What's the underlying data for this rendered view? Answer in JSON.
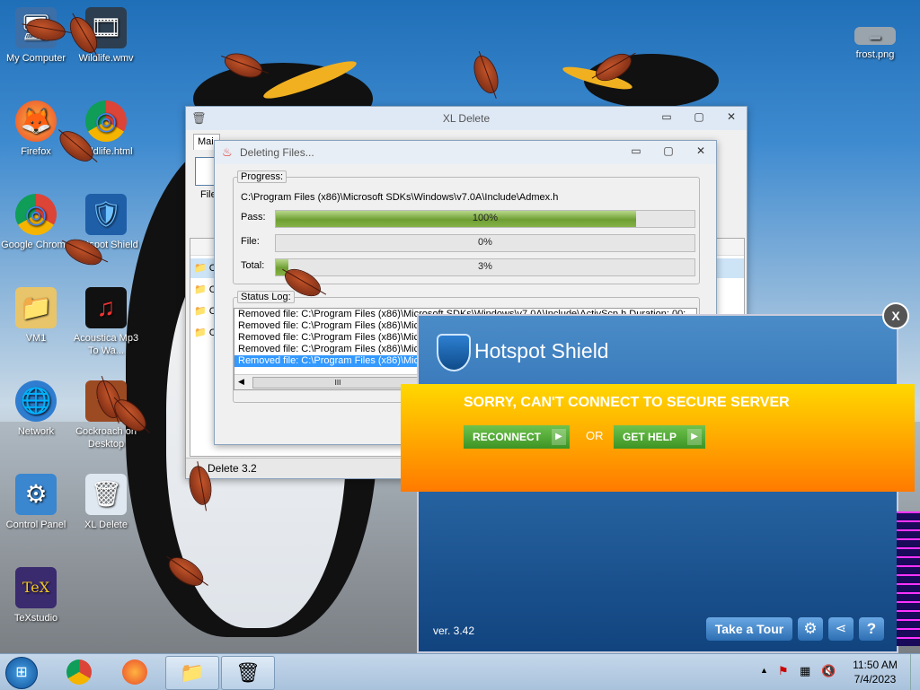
{
  "desktop": {
    "icons": [
      {
        "name": "my-computer",
        "label": "My Computer",
        "glyph": "🖥"
      },
      {
        "name": "wildlife",
        "label": "Wildlife.wmv",
        "glyph": "🎞"
      },
      {
        "name": "firefox",
        "label": "Firefox",
        "glyph": "🦊"
      },
      {
        "name": "wildlife-html",
        "label": "Wildlife.html",
        "glyph": "◎"
      },
      {
        "name": "google-chrome",
        "label": "Google Chrome",
        "glyph": "◎"
      },
      {
        "name": "hotspot-shield",
        "label": "Hotspot Shield",
        "glyph": "🛡"
      },
      {
        "name": "vm1",
        "label": "VM1",
        "glyph": "📁"
      },
      {
        "name": "acoustica",
        "label": "Acoustica Mp3 To Wa...",
        "glyph": "♫"
      },
      {
        "name": "network",
        "label": "Network",
        "glyph": "🌐"
      },
      {
        "name": "cockroach",
        "label": "Cockroach on Desktop",
        "glyph": "✦"
      },
      {
        "name": "control-panel",
        "label": "Control Panel",
        "glyph": "⚙"
      },
      {
        "name": "xl-delete",
        "label": "XL Delete",
        "glyph": "🗑"
      },
      {
        "name": "texstudio",
        "label": "TeXstudio",
        "glyph": "TeX"
      },
      {
        "name": "frost",
        "label": "frost.png",
        "glyph": "▬"
      }
    ]
  },
  "xl_delete": {
    "title": "XL Delete",
    "tab": "Mai",
    "file_label": "File",
    "status": "Delete 3.2",
    "rows": [
      "C",
      "C",
      "C",
      "C"
    ]
  },
  "deleting": {
    "title": "Deleting Files...",
    "progress_legend": "Progress:",
    "path": "C:\\Program Files (x86)\\Microsoft SDKs\\Windows\\v7.0A\\Include\\Admex.h",
    "pass_label": "Pass:",
    "pass_value": 100,
    "pass_text": "100%",
    "file_label": "File:",
    "file_value": 0,
    "file_text": "0%",
    "total_label": "Total:",
    "total_value": 3,
    "total_text": "3%",
    "status_legend": "Status Log:",
    "log": [
      "Removed file: C:\\Program Files (x86)\\Microsoft SDKs\\Windows\\v7.0A\\Include\\ActivScp.h Duration: 00:",
      "Removed file: C:\\Program Files (x86)\\Micro",
      "Removed file: C:\\Program Files (x86)\\Micro",
      "Removed file: C:\\Program Files (x86)\\Micro",
      "Removed file: C:\\Program Files (x86)\\Micro"
    ],
    "scroll_thumb": "III"
  },
  "hotspot": {
    "brand": "Hotspot Shield",
    "close": "X",
    "message": "SORRY, CAN'T CONNECT TO SECURE SERVER",
    "reconnect": "RECONNECT",
    "or": "OR",
    "get_help": "GET HELP",
    "version": "ver. 3.42",
    "take_tour": "Take a Tour",
    "colors": {
      "banner": "#ffb300",
      "button": "#4aa82e",
      "panel": "#2b6aa8"
    }
  },
  "taskbar": {
    "time": "11:50 AM",
    "date": "7/4/2023",
    "tray_up": "▲"
  }
}
